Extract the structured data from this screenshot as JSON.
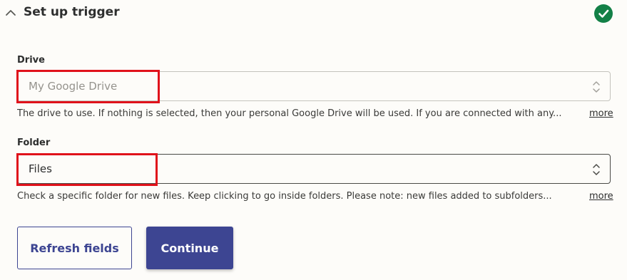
{
  "section": {
    "title": "Set up trigger",
    "collapse_icon": "chevron-up-icon",
    "status_icon": "check-circle-icon",
    "status_color": "#138047"
  },
  "fields": {
    "drive": {
      "label": "Drive",
      "placeholder": "My Google Drive",
      "help": "The drive to use. If nothing is selected, then your personal Google Drive will be used. If you are connected with any...",
      "more": "more"
    },
    "folder": {
      "label": "Folder",
      "value": "Files",
      "help": "Check a specific folder for new files. Keep clicking to go inside folders. Please note: new files added to subfolders...",
      "more": "more"
    }
  },
  "buttons": {
    "refresh": "Refresh fields",
    "continue": "Continue"
  },
  "colors": {
    "accent": "#3d4592",
    "highlight": "#e0121b",
    "background": "#fdfcf9"
  }
}
